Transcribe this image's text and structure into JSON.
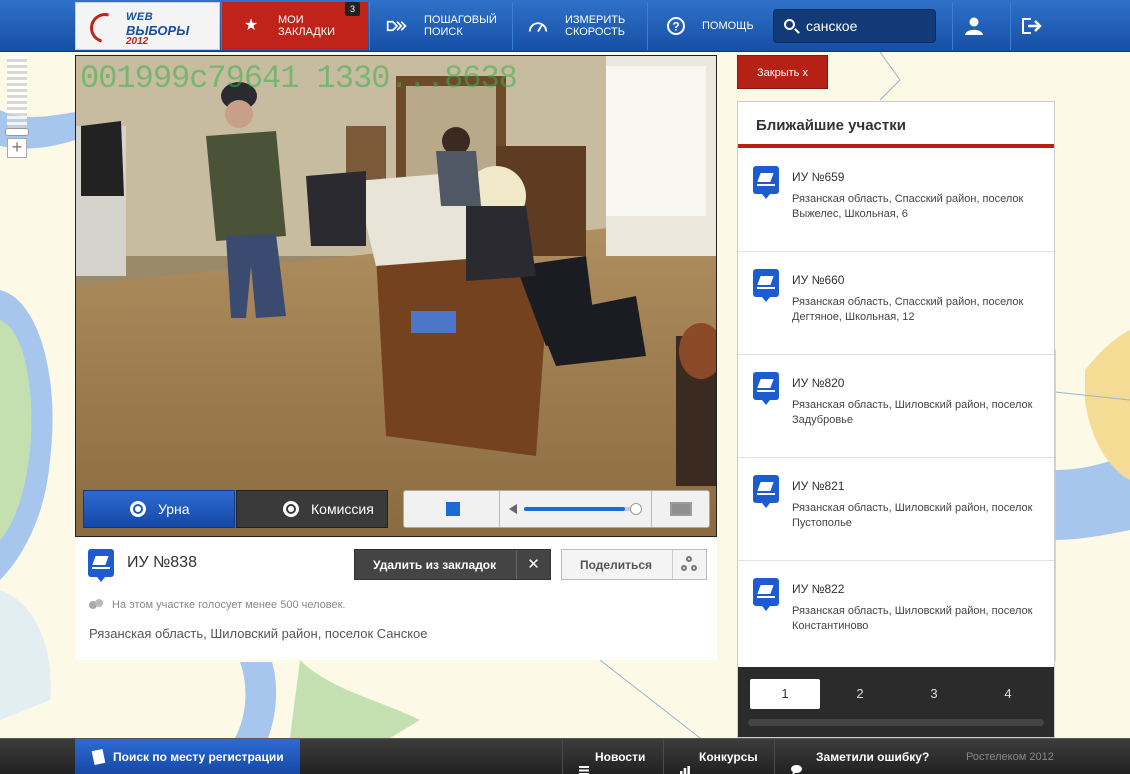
{
  "header": {
    "logo": {
      "line1": "WEB",
      "line2": "ВЫБОРЫ",
      "line3": "2012"
    },
    "nav": [
      {
        "label": "МОИ ЗАКЛАДКИ",
        "icon": "star-icon",
        "badge": "3"
      },
      {
        "label": "ПОШАГОВЫЙ ПОИСК",
        "icon": "step-search-icon"
      },
      {
        "label": "ИЗМЕРИТЬ СКОРОСТЬ",
        "icon": "speedometer-icon"
      },
      {
        "label": "ПОМОЩЬ",
        "icon": "help-icon"
      }
    ],
    "search": {
      "value": "санское",
      "icon": "search-icon"
    },
    "user_icon": "user-icon",
    "logout_icon": "logout-icon"
  },
  "video": {
    "osd_text": "001999c79641 1330...8638",
    "tabs": [
      {
        "label": "Урна",
        "icon": "camera-icon",
        "active": true
      },
      {
        "label": "Комиссия",
        "icon": "camera-icon",
        "active": false
      }
    ],
    "controls": {
      "stop_icon": "stop-icon",
      "volume_icon": "speaker-icon",
      "volume_level": 0.92,
      "fullscreen_icon": "fullscreen-icon"
    }
  },
  "station_info": {
    "title": "ИУ №838",
    "remove_label": "Удалить из закладок",
    "remove_icon": "close-icon",
    "share_label": "Поделиться",
    "share_icon": "share-icon",
    "voters_note": "На этом участке голосует менее 500 человек.",
    "address": "Рязанская область, Шиловский район, поселок Санское"
  },
  "nearest": {
    "close_label": "Закрыть  x",
    "title": "Ближайшие участки",
    "items": [
      {
        "name": "ИУ №659",
        "address": "Рязанская область, Спасский район, поселок Выжелес, Школьная, 6"
      },
      {
        "name": "ИУ №660",
        "address": "Рязанская область, Спасский район, поселок Дегтяное, Школьная, 12"
      },
      {
        "name": "ИУ №820",
        "address": "Рязанская область, Шиловский район, поселок Задубровье"
      },
      {
        "name": "ИУ №821",
        "address": "Рязанская область, Шиловский район, поселок Пустополье"
      },
      {
        "name": "ИУ №822",
        "address": "Рязанская область, Шиловский район, поселок Константиново"
      }
    ],
    "pages": [
      "1",
      "2",
      "3",
      "4"
    ],
    "current_page": "1"
  },
  "footer": {
    "reg_search": "Поиск по месту регистрации",
    "news": "Новости",
    "contests": "Конкурсы",
    "error": "Заметили ошибку?",
    "copyright": "Ростелеком 2012"
  },
  "colors": {
    "brand_blue": "#1a55b8",
    "accent_red": "#c0231a",
    "dark_bar": "#2b2b2b"
  }
}
